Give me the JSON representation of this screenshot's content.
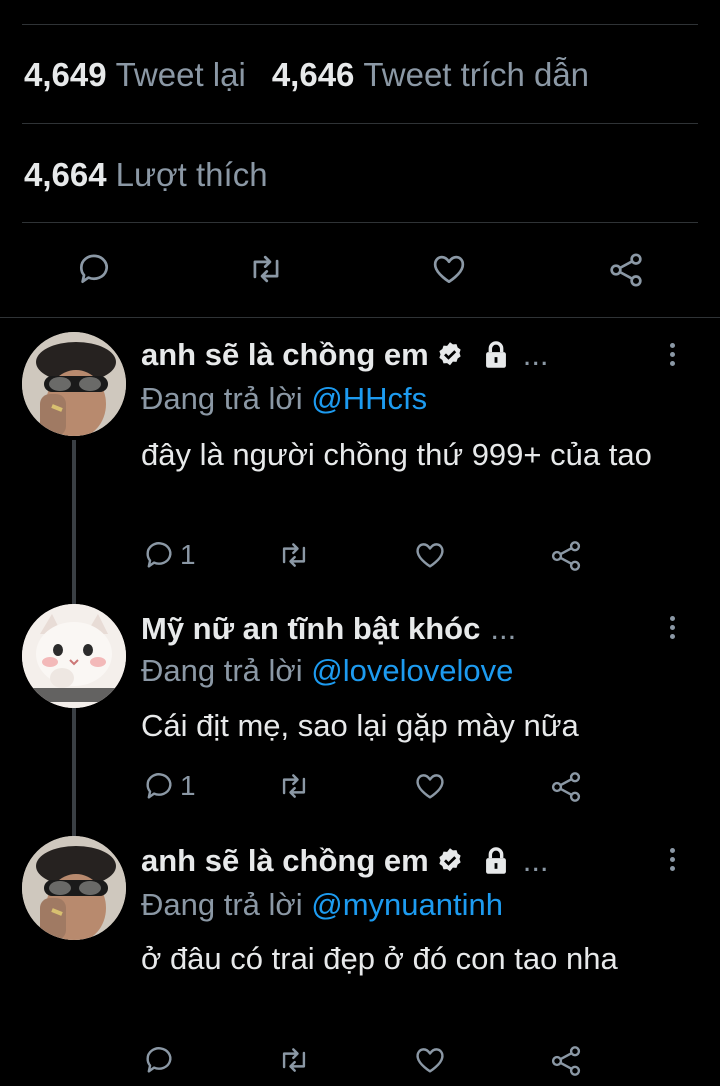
{
  "stats": {
    "retweets": {
      "count": "4,649",
      "label": "Tweet lại"
    },
    "quotes": {
      "count": "4,646",
      "label": "Tweet trích dẫn"
    },
    "likes": {
      "count": "4,664",
      "label": "Lượt thích"
    }
  },
  "main_actions": {
    "icons": [
      "reply-icon",
      "retweet-icon",
      "like-icon",
      "share-icon"
    ]
  },
  "replies": [
    {
      "name": "anh sẽ là chồng em",
      "verified": true,
      "locked": true,
      "ellipsis": "...",
      "replying_prefix": "Đang trả lời",
      "replying_handle": "@HHcfs",
      "text": "đây là người chồng thứ 999+ của tao",
      "reply_count": "1",
      "avatar": "man-with-sunglasses"
    },
    {
      "name": "Mỹ nữ an tĩnh bật khóc",
      "verified": false,
      "locked": false,
      "ellipsis": "...",
      "replying_prefix": "Đang trả lời",
      "replying_handle": "@lovelovelove",
      "text": "Cái địt mẹ, sao lại gặp mày nữa",
      "reply_count": "1",
      "avatar": "white-cat"
    },
    {
      "name": "anh sẽ là chồng em",
      "verified": true,
      "locked": true,
      "ellipsis": "...",
      "replying_prefix": "Đang trả lời",
      "replying_handle": "@mynuantinh",
      "text": "ở đâu có trai đẹp ở đó con tao nha",
      "reply_count": "",
      "avatar": "man-with-sunglasses"
    }
  ],
  "colors": {
    "background": "#000000",
    "text": "#e7e9ea",
    "muted": "#8b98a5",
    "link": "#1d9bf0",
    "divider": "#2f3336"
  }
}
